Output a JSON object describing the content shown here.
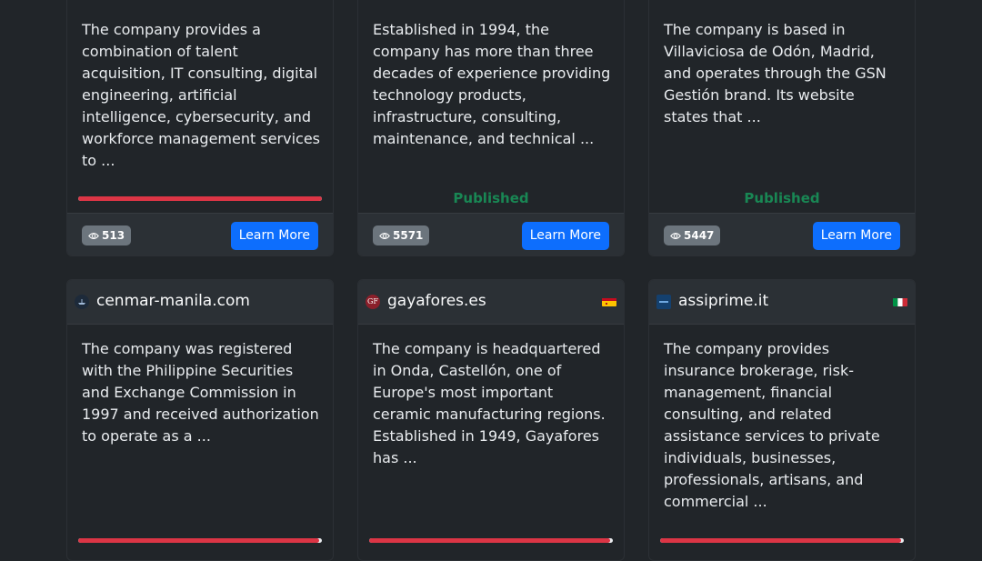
{
  "cards": [
    {
      "description": "The company provides a combination of talent acquisition, IT consulting, digital engineering, artificial intelligence, cybersecurity, and workforce management services to ...",
      "progress": 1.0,
      "views": "513",
      "button_label": "Learn More"
    },
    {
      "description": "Established in 1994, the company has more than three decades of experience providing technology products, infrastructure, consulting, maintenance, and technical ...",
      "status": "Published",
      "views": "5571",
      "button_label": "Learn More"
    },
    {
      "description": "The company is based in Villaviciosa de Odón, Madrid, and operates through the GSN Gestión brand. Its website states that ...",
      "status": "Published",
      "views": "5447",
      "button_label": "Learn More"
    },
    {
      "domain": "cenmar-manila.com",
      "favicon_icon": "ship-logo-icon",
      "description": "The company was registered with the Philippine Securities and Exchange Commission in 1997 and received authorization to operate as a ...",
      "progress": 0.99
    },
    {
      "domain": "gayafores.es",
      "favicon_icon": "gayafores-logo-icon",
      "favicon_text": "GF",
      "flag_icon": "spain-flag-icon",
      "description": "The company is headquartered in Onda, Castellón, one of Europe's most important ceramic manufacturing regions. Established in 1949, Gayafores has ...",
      "progress": 0.99
    },
    {
      "domain": "assiprime.it",
      "favicon_icon": "assiprime-logo-icon",
      "flag_icon": "italy-flag-icon",
      "description": "The company provides insurance brokerage, risk-management, financial consulting, and related assistance services to private individuals, businesses, professionals, artisans, and commercial ...",
      "progress": 0.99
    }
  ],
  "colors": {
    "background": "#212529",
    "card_header": "#2b3035",
    "progress_danger": "#dc3545",
    "status_success": "#198754",
    "button_primary": "#0d6efd",
    "badge_secondary": "#6c757d"
  }
}
